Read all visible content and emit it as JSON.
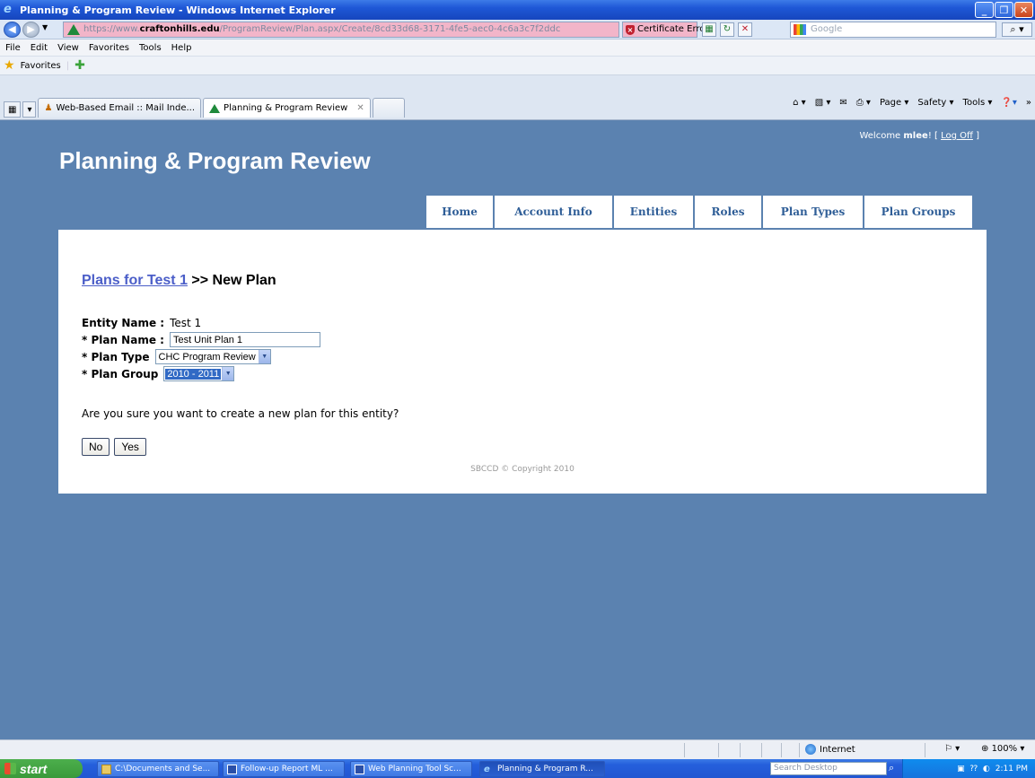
{
  "window": {
    "title": "Planning & Program Review - Windows Internet Explorer"
  },
  "address_bar": {
    "url_prefix": "https://www.",
    "url_host": "craftonhills.edu",
    "url_path": "/ProgramReview/Plan.aspx/Create/8cd33d68-3171-4fe5-aec0-4c6a3c7f2ddc",
    "cert_error": "Certificate Error",
    "search_placeholder": "Google"
  },
  "menu": [
    "File",
    "Edit",
    "View",
    "Favorites",
    "Tools",
    "Help"
  ],
  "favorites_bar": {
    "label": "Favorites"
  },
  "tabs": [
    {
      "label": "Web-Based Email :: Mail Inde..."
    },
    {
      "label": "Planning & Program Review"
    }
  ],
  "command_bar": {
    "page": "Page ▾",
    "safety": "Safety ▾",
    "tools": "Tools ▾"
  },
  "header": {
    "welcome_prefix": "Welcome ",
    "username": "mlee",
    "welcome_suffix": "! [ ",
    "logoff": "Log Off",
    "welcome_end": " ]",
    "app_title": "Planning & Program Review"
  },
  "nav": [
    {
      "label": "Home"
    },
    {
      "label": "Account Info"
    },
    {
      "label": "Entities"
    },
    {
      "label": "Roles"
    },
    {
      "label": "Plan Types"
    },
    {
      "label": "Plan Groups"
    }
  ],
  "breadcrumb": {
    "link": "Plans for Test 1",
    "current": ">> New Plan"
  },
  "form": {
    "entity_label": "Entity Name :",
    "entity_value": "Test 1",
    "plan_name_label": "* Plan Name :",
    "plan_name_value": "Test Unit Plan 1",
    "plan_type_label": "* Plan Type",
    "plan_type_value": "CHC Program Review",
    "plan_group_label": "* Plan Group",
    "plan_group_value": "2010 - 2011"
  },
  "confirm_text": "Are you sure you want to create a new plan for this entity?",
  "buttons": {
    "no": "No",
    "yes": "Yes"
  },
  "footer": {
    "copyright": "SBCCD © Copyright 2010"
  },
  "status_bar": {
    "zone": "Internet",
    "zoom": "100%"
  },
  "taskbar": {
    "start": "start",
    "tasks": [
      {
        "label": "C:\\Documents and Se..."
      },
      {
        "label": "Follow-up Report ML ..."
      },
      {
        "label": "Web Planning Tool Sc..."
      },
      {
        "label": "Planning & Program R..."
      }
    ],
    "search_placeholder": "Search Desktop",
    "clock": "2:11 PM"
  },
  "colors": {
    "page_bg": "#5b82b0",
    "nav_text": "#2f5e97",
    "link": "#4b5ec8"
  }
}
